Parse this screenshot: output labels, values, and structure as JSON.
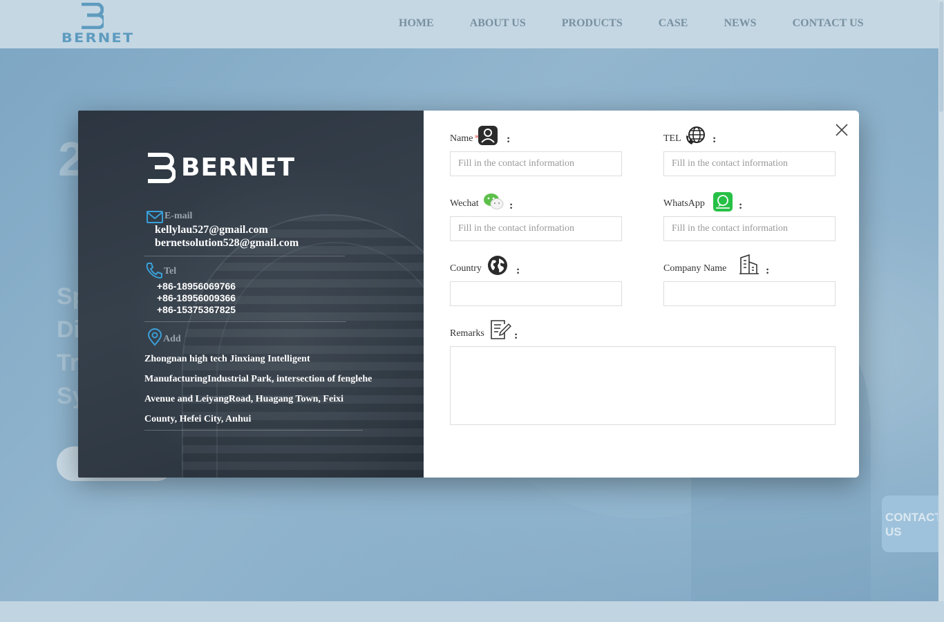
{
  "header": {
    "logo_text": "BERNET",
    "nav": [
      "HOME",
      "ABOUT US",
      "PRODUCTS",
      "CASE",
      "NEWS",
      "CONTACT US"
    ]
  },
  "hero": {
    "title_fragment": "2",
    "subtitle_fragments": [
      "Sp",
      "Di",
      "Tr",
      "Sy"
    ]
  },
  "side_contact": {
    "label": "CONTACT US"
  },
  "modal": {
    "logo_text": "BERNET",
    "email": {
      "label": "E-mail",
      "values": [
        "kellylau527@gmail.com",
        "bernetsolution528@gmail.com"
      ]
    },
    "tel": {
      "label": "Tel",
      "values": [
        "+86-18956069766",
        "+86-18956009366",
        "+86-15375367825"
      ]
    },
    "address": {
      "label": "Add",
      "lines": [
        "Zhongnan high tech Jinxiang Intelligent",
        "ManufacturingIndustrial Park, intersection of fenglehe",
        "Avenue and LeiyangRoad, Huagang Town, Feixi",
        "County, Hefei City, Anhui"
      ]
    },
    "form": {
      "colon": ":",
      "required_mark": "*",
      "name": {
        "label": "Name",
        "placeholder": "Fill in the contact information",
        "value": ""
      },
      "tel": {
        "label": "TEL",
        "placeholder": "Fill in the contact information",
        "value": ""
      },
      "wechat": {
        "label": "Wechat",
        "placeholder": "Fill in the contact information",
        "value": ""
      },
      "whatsapp": {
        "label": "WhatsApp",
        "placeholder": "Fill in the contact information",
        "value": ""
      },
      "country": {
        "label": "Country",
        "placeholder": "",
        "value": ""
      },
      "company": {
        "label": "Company Name",
        "placeholder": "",
        "value": ""
      },
      "remarks": {
        "label": "Remarks",
        "placeholder": "",
        "value": ""
      }
    }
  },
  "colors": {
    "accent": "#3aa0d8",
    "modal_dark": "#2f3944",
    "wechat_green": "#5cc04a",
    "whatsapp_green": "#27c046",
    "required_red": "#e45656"
  },
  "icons": {
    "email": "mail-icon",
    "tel": "phone-icon",
    "address": "location-pin-icon",
    "name": "user-icon",
    "tel_field": "globe-phone-icon",
    "wechat": "wechat-icon",
    "whatsapp": "whatsapp-icon",
    "country": "world-icon",
    "company": "building-icon",
    "remarks": "edit-icon",
    "close": "close-icon"
  }
}
